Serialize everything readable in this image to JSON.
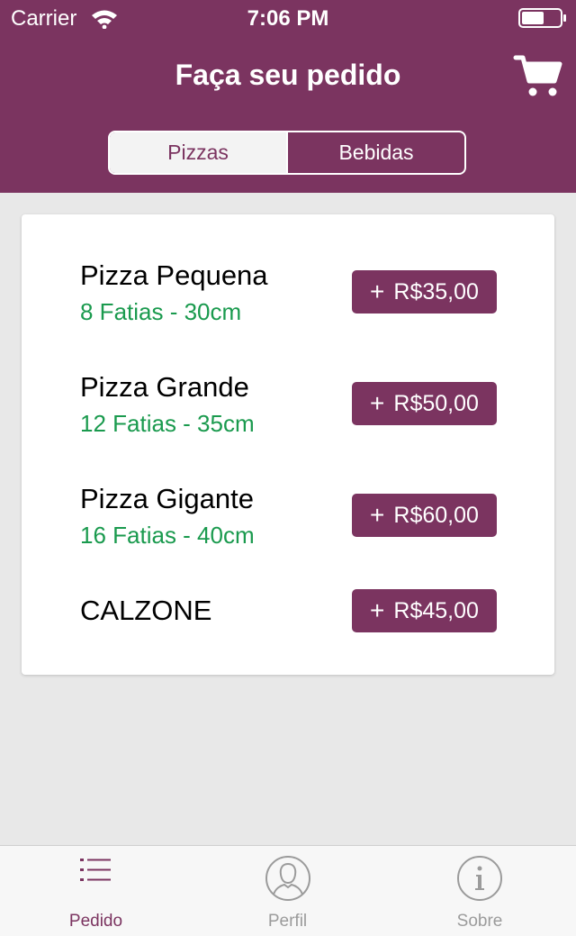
{
  "status_bar": {
    "carrier": "Carrier",
    "time": "7:06 PM"
  },
  "header": {
    "title": "Faça seu pedido",
    "cart_icon": "cart-icon",
    "background": "#7b3460"
  },
  "segments": {
    "items": [
      "Pizzas",
      "Bebidas"
    ],
    "selected": "Pizzas"
  },
  "menu": {
    "items": [
      {
        "name": "Pizza Pequena",
        "description": "8 Fatias - 30cm",
        "price": "R$35,00"
      },
      {
        "name": "Pizza Grande",
        "description": "12 Fatias - 35cm",
        "price": "R$50,00"
      },
      {
        "name": "Pizza Gigante",
        "description": "16 Fatias - 40cm",
        "price": "R$60,00"
      },
      {
        "name": "CALZONE",
        "description": "",
        "price": "R$45,00"
      }
    ],
    "add_symbol": "+"
  },
  "tabbar": {
    "tabs": [
      {
        "label": "Pedido",
        "icon": "list-icon",
        "active": true
      },
      {
        "label": "Perfil",
        "icon": "profile-icon",
        "active": false
      },
      {
        "label": "Sobre",
        "icon": "info-icon",
        "active": false
      }
    ]
  },
  "colors": {
    "accent": "#7b3460",
    "description_green": "#1a9a4e",
    "inactive_tab": "#9b9b9b",
    "background": "#e8e8e8"
  }
}
